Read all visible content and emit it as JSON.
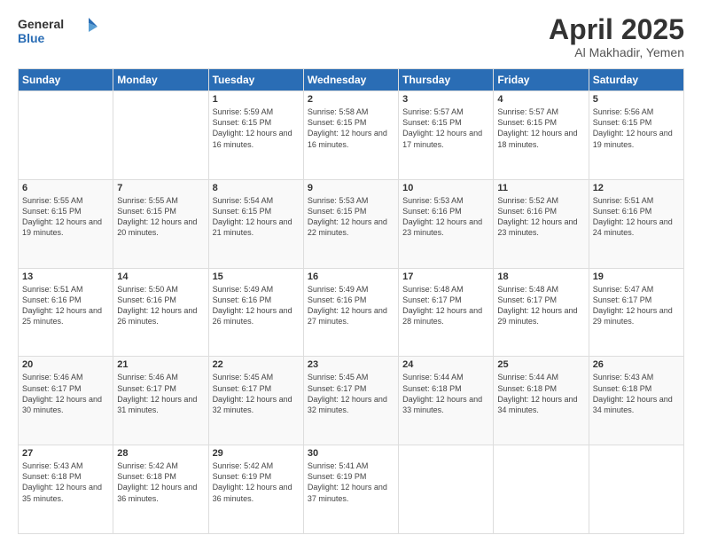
{
  "logo": {
    "general": "General",
    "blue": "Blue"
  },
  "title": {
    "month": "April 2025",
    "location": "Al Makhadir, Yemen"
  },
  "weekdays": [
    "Sunday",
    "Monday",
    "Tuesday",
    "Wednesday",
    "Thursday",
    "Friday",
    "Saturday"
  ],
  "weeks": [
    [
      {
        "day": null,
        "info": null
      },
      {
        "day": null,
        "info": null
      },
      {
        "day": "1",
        "info": "Sunrise: 5:59 AM\nSunset: 6:15 PM\nDaylight: 12 hours and 16 minutes."
      },
      {
        "day": "2",
        "info": "Sunrise: 5:58 AM\nSunset: 6:15 PM\nDaylight: 12 hours and 16 minutes."
      },
      {
        "day": "3",
        "info": "Sunrise: 5:57 AM\nSunset: 6:15 PM\nDaylight: 12 hours and 17 minutes."
      },
      {
        "day": "4",
        "info": "Sunrise: 5:57 AM\nSunset: 6:15 PM\nDaylight: 12 hours and 18 minutes."
      },
      {
        "day": "5",
        "info": "Sunrise: 5:56 AM\nSunset: 6:15 PM\nDaylight: 12 hours and 19 minutes."
      }
    ],
    [
      {
        "day": "6",
        "info": "Sunrise: 5:55 AM\nSunset: 6:15 PM\nDaylight: 12 hours and 19 minutes."
      },
      {
        "day": "7",
        "info": "Sunrise: 5:55 AM\nSunset: 6:15 PM\nDaylight: 12 hours and 20 minutes."
      },
      {
        "day": "8",
        "info": "Sunrise: 5:54 AM\nSunset: 6:15 PM\nDaylight: 12 hours and 21 minutes."
      },
      {
        "day": "9",
        "info": "Sunrise: 5:53 AM\nSunset: 6:15 PM\nDaylight: 12 hours and 22 minutes."
      },
      {
        "day": "10",
        "info": "Sunrise: 5:53 AM\nSunset: 6:16 PM\nDaylight: 12 hours and 23 minutes."
      },
      {
        "day": "11",
        "info": "Sunrise: 5:52 AM\nSunset: 6:16 PM\nDaylight: 12 hours and 23 minutes."
      },
      {
        "day": "12",
        "info": "Sunrise: 5:51 AM\nSunset: 6:16 PM\nDaylight: 12 hours and 24 minutes."
      }
    ],
    [
      {
        "day": "13",
        "info": "Sunrise: 5:51 AM\nSunset: 6:16 PM\nDaylight: 12 hours and 25 minutes."
      },
      {
        "day": "14",
        "info": "Sunrise: 5:50 AM\nSunset: 6:16 PM\nDaylight: 12 hours and 26 minutes."
      },
      {
        "day": "15",
        "info": "Sunrise: 5:49 AM\nSunset: 6:16 PM\nDaylight: 12 hours and 26 minutes."
      },
      {
        "day": "16",
        "info": "Sunrise: 5:49 AM\nSunset: 6:16 PM\nDaylight: 12 hours and 27 minutes."
      },
      {
        "day": "17",
        "info": "Sunrise: 5:48 AM\nSunset: 6:17 PM\nDaylight: 12 hours and 28 minutes."
      },
      {
        "day": "18",
        "info": "Sunrise: 5:48 AM\nSunset: 6:17 PM\nDaylight: 12 hours and 29 minutes."
      },
      {
        "day": "19",
        "info": "Sunrise: 5:47 AM\nSunset: 6:17 PM\nDaylight: 12 hours and 29 minutes."
      }
    ],
    [
      {
        "day": "20",
        "info": "Sunrise: 5:46 AM\nSunset: 6:17 PM\nDaylight: 12 hours and 30 minutes."
      },
      {
        "day": "21",
        "info": "Sunrise: 5:46 AM\nSunset: 6:17 PM\nDaylight: 12 hours and 31 minutes."
      },
      {
        "day": "22",
        "info": "Sunrise: 5:45 AM\nSunset: 6:17 PM\nDaylight: 12 hours and 32 minutes."
      },
      {
        "day": "23",
        "info": "Sunrise: 5:45 AM\nSunset: 6:17 PM\nDaylight: 12 hours and 32 minutes."
      },
      {
        "day": "24",
        "info": "Sunrise: 5:44 AM\nSunset: 6:18 PM\nDaylight: 12 hours and 33 minutes."
      },
      {
        "day": "25",
        "info": "Sunrise: 5:44 AM\nSunset: 6:18 PM\nDaylight: 12 hours and 34 minutes."
      },
      {
        "day": "26",
        "info": "Sunrise: 5:43 AM\nSunset: 6:18 PM\nDaylight: 12 hours and 34 minutes."
      }
    ],
    [
      {
        "day": "27",
        "info": "Sunrise: 5:43 AM\nSunset: 6:18 PM\nDaylight: 12 hours and 35 minutes."
      },
      {
        "day": "28",
        "info": "Sunrise: 5:42 AM\nSunset: 6:18 PM\nDaylight: 12 hours and 36 minutes."
      },
      {
        "day": "29",
        "info": "Sunrise: 5:42 AM\nSunset: 6:19 PM\nDaylight: 12 hours and 36 minutes."
      },
      {
        "day": "30",
        "info": "Sunrise: 5:41 AM\nSunset: 6:19 PM\nDaylight: 12 hours and 37 minutes."
      },
      {
        "day": null,
        "info": null
      },
      {
        "day": null,
        "info": null
      },
      {
        "day": null,
        "info": null
      }
    ]
  ]
}
